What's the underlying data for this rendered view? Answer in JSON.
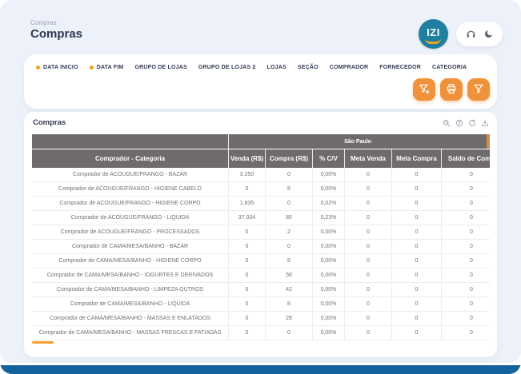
{
  "colors": {
    "accent_orange": "#F0923C",
    "required_dot_orange": "#F5A01E",
    "table_header_gray": "#6F6B6B",
    "group_sliver_orange": "#D09048",
    "logo_teal": "#1E7F9F",
    "footer_blue": "#15639C",
    "page_background": "#EDF1F9"
  },
  "header": {
    "breadcrumb": "Compras",
    "title": "Compras",
    "logo_text": "IZI",
    "action_icons": [
      "headset-icon",
      "moon-icon"
    ]
  },
  "filters": {
    "items": [
      {
        "label": "DATA INICIO",
        "required": true
      },
      {
        "label": "DATA FIM",
        "required": true
      },
      {
        "label": "GRUPO DE LOJAS",
        "required": false
      },
      {
        "label": "GRUPO DE LOJAS 2",
        "required": false
      },
      {
        "label": "LOJAS",
        "required": false
      },
      {
        "label": "SEÇÃO",
        "required": false
      },
      {
        "label": "COMPRADOR",
        "required": false
      },
      {
        "label": "FORNECEDOR",
        "required": false
      },
      {
        "label": "CATEGORIA",
        "required": false
      }
    ],
    "button_icons": [
      "funnel-x-icon",
      "printer-icon",
      "funnel-icon"
    ]
  },
  "table": {
    "title": "Compras",
    "toolbar_icons": [
      "magnifier-icon",
      "help-icon",
      "refresh-icon",
      "download-icon"
    ],
    "group_header": "São Paulo",
    "columns": [
      "Comprador - Categoria",
      "Venda (R$)",
      "Compra (R$)",
      "% C/V",
      "Meta Venda",
      "Meta Compra",
      "Saldo de Comp"
    ],
    "rows": [
      [
        "Comprador de ACOUGUE/FRANGO - BAZAR",
        "3.250",
        "0",
        "0,00%",
        "0",
        "0",
        "0"
      ],
      [
        "Comprador de ACOUGUE/FRANGO - HIGIENE CABELO",
        "0",
        "8",
        "0,00%",
        "0",
        "0",
        "0"
      ],
      [
        "Comprador de ACOUGUE/FRANGO - HIGIENE CORPO",
        "1.835",
        "0",
        "0,02%",
        "0",
        "0",
        "0"
      ],
      [
        "Comprador de ACOUGUE/FRANGO - LIQUIDA",
        "37.034",
        "85",
        "0,23%",
        "0",
        "0",
        "0"
      ],
      [
        "Comprador de ACOUGUE/FRANGO - PROCESSADOS",
        "0",
        "2",
        "0,00%",
        "0",
        "0",
        "0"
      ],
      [
        "Comprador de CAMA/MESA/BANHO - BAZAR",
        "0",
        "0",
        "0,00%",
        "0",
        "0",
        "0"
      ],
      [
        "Comprador de CAMA/MESA/BANHO - HIGIENE CORPO",
        "0",
        "8",
        "0,00%",
        "0",
        "0",
        "0"
      ],
      [
        "Comprador de CAMA/MESA/BANHO - IOGURTES E DERIVADOS",
        "0",
        "56",
        "0,00%",
        "0",
        "0",
        "0"
      ],
      [
        "Comprador de CAMA/MESA/BANHO - LIMPEZA OUTROS",
        "0",
        "42",
        "0,00%",
        "0",
        "0",
        "0"
      ],
      [
        "Comprador de CAMA/MESA/BANHO - LIQUIDA",
        "0",
        "8",
        "0,00%",
        "0",
        "0",
        "0"
      ],
      [
        "Comprador de CAMA/MESA/BANHO - MASSAS E ENLATADOS",
        "0",
        "28",
        "0,00%",
        "0",
        "0",
        "0"
      ],
      [
        "Comprador de CAMA/MESA/BANHO - MASSAS FRESCAS E FATIADAS",
        "0",
        "0",
        "0,00%",
        "0",
        "0",
        "0"
      ]
    ]
  }
}
